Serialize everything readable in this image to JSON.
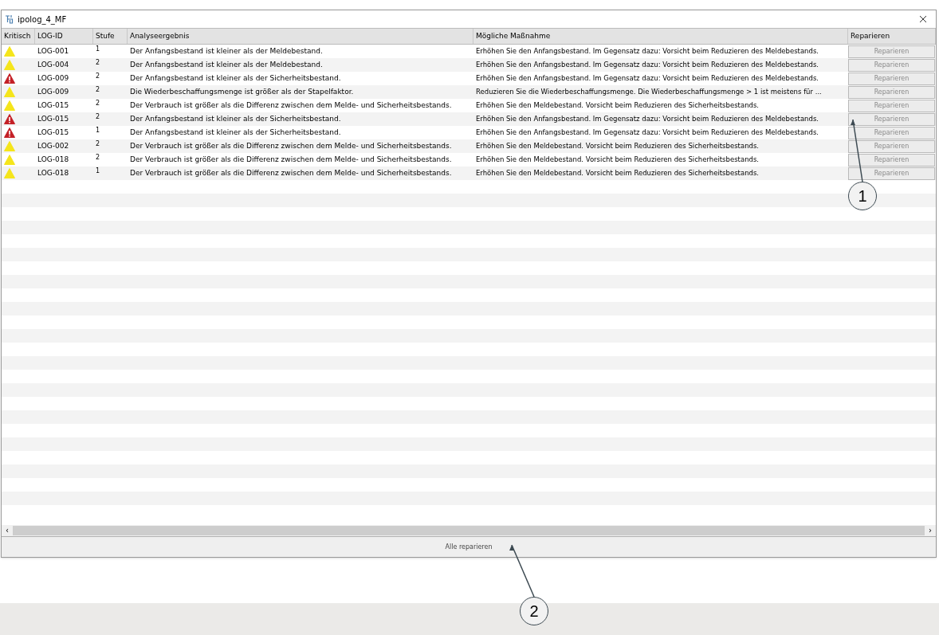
{
  "window": {
    "title": "ipolog_4_MF"
  },
  "table": {
    "columns": [
      "Kritisch",
      "LOG-ID",
      "Stufe",
      "Analyseergebnis",
      "Mögliche Maßnahme",
      "Reparieren"
    ],
    "rows": [
      {
        "kind": "warning",
        "log_id": "LOG-001",
        "stufe": "1",
        "result": "Der Anfangsbestand ist kleiner als der Meldebestand.",
        "action": "Erhöhen Sie den Anfangsbestand. Im Gegensatz dazu: Vorsicht beim Reduzieren des Meldebestands.",
        "button": "Reparieren"
      },
      {
        "kind": "warning",
        "log_id": "LOG-004",
        "stufe": "2",
        "result": "Der Anfangsbestand ist kleiner als der Meldebestand.",
        "action": "Erhöhen Sie den Anfangsbestand. Im Gegensatz dazu: Vorsicht beim Reduzieren des Meldebestands.",
        "button": "Reparieren"
      },
      {
        "kind": "critical",
        "log_id": "LOG-009",
        "stufe": "2",
        "result": "Der Anfangsbestand ist kleiner als der Sicherheitsbestand.",
        "action": "Erhöhen Sie den Anfangsbestand. Im Gegensatz dazu: Vorsicht beim Reduzieren des Meldebestands.",
        "button": "Reparieren"
      },
      {
        "kind": "warning",
        "log_id": "LOG-009",
        "stufe": "2",
        "result": "Die Wiederbeschaffungsmenge ist größer als der Stapelfaktor.",
        "action": "Reduzieren Sie die Wiederbeschaffungsmenge. Die Wiederbeschaffungsmenge > 1 ist meistens für ...",
        "button": "Reparieren"
      },
      {
        "kind": "warning",
        "log_id": "LOG-015",
        "stufe": "2",
        "result": "Der Verbrauch ist größer als die Differenz zwischen dem Melde- und Sicherheitsbestands.",
        "action": "Erhöhen Sie den Meldebestand. Vorsicht beim Reduzieren des Sicherheitsbestands.",
        "button": "Reparieren"
      },
      {
        "kind": "critical",
        "log_id": "LOG-015",
        "stufe": "2",
        "result": "Der Anfangsbestand ist kleiner als der Sicherheitsbestand.",
        "action": "Erhöhen Sie den Anfangsbestand. Im Gegensatz dazu: Vorsicht beim Reduzieren des Meldebestands.",
        "button": "Reparieren"
      },
      {
        "kind": "critical",
        "log_id": "LOG-015",
        "stufe": "1",
        "result": "Der Anfangsbestand ist kleiner als der Sicherheitsbestand.",
        "action": "Erhöhen Sie den Anfangsbestand. Im Gegensatz dazu: Vorsicht beim Reduzieren des Meldebestands.",
        "button": "Reparieren"
      },
      {
        "kind": "warning",
        "log_id": "LOG-002",
        "stufe": "2",
        "result": "Der Verbrauch ist größer als die Differenz zwischen dem Melde- und Sicherheitsbestands.",
        "action": "Erhöhen Sie den Meldebestand. Vorsicht beim Reduzieren des Sicherheitsbestands.",
        "button": "Reparieren"
      },
      {
        "kind": "warning",
        "log_id": "LOG-018",
        "stufe": "2",
        "result": "Der Verbrauch ist größer als die Differenz zwischen dem Melde- und Sicherheitsbestands.",
        "action": "Erhöhen Sie den Meldebestand. Vorsicht beim Reduzieren des Sicherheitsbestands.",
        "button": "Reparieren"
      },
      {
        "kind": "warning",
        "log_id": "LOG-018",
        "stufe": "1",
        "result": "Der Verbrauch ist größer als die Differenz zwischen dem Melde- und Sicherheitsbestands.",
        "action": "Erhöhen Sie den Meldebestand. Vorsicht beim Reduzieren des Sicherheitsbestands.",
        "button": "Reparieren"
      }
    ]
  },
  "repair_all_button": "Alle reparieren",
  "scrollbar": {
    "left_arrow": "‹",
    "right_arrow": "›"
  },
  "callouts": [
    {
      "label": "1",
      "kind": "row"
    },
    {
      "label": "2",
      "kind": "footer"
    }
  ]
}
